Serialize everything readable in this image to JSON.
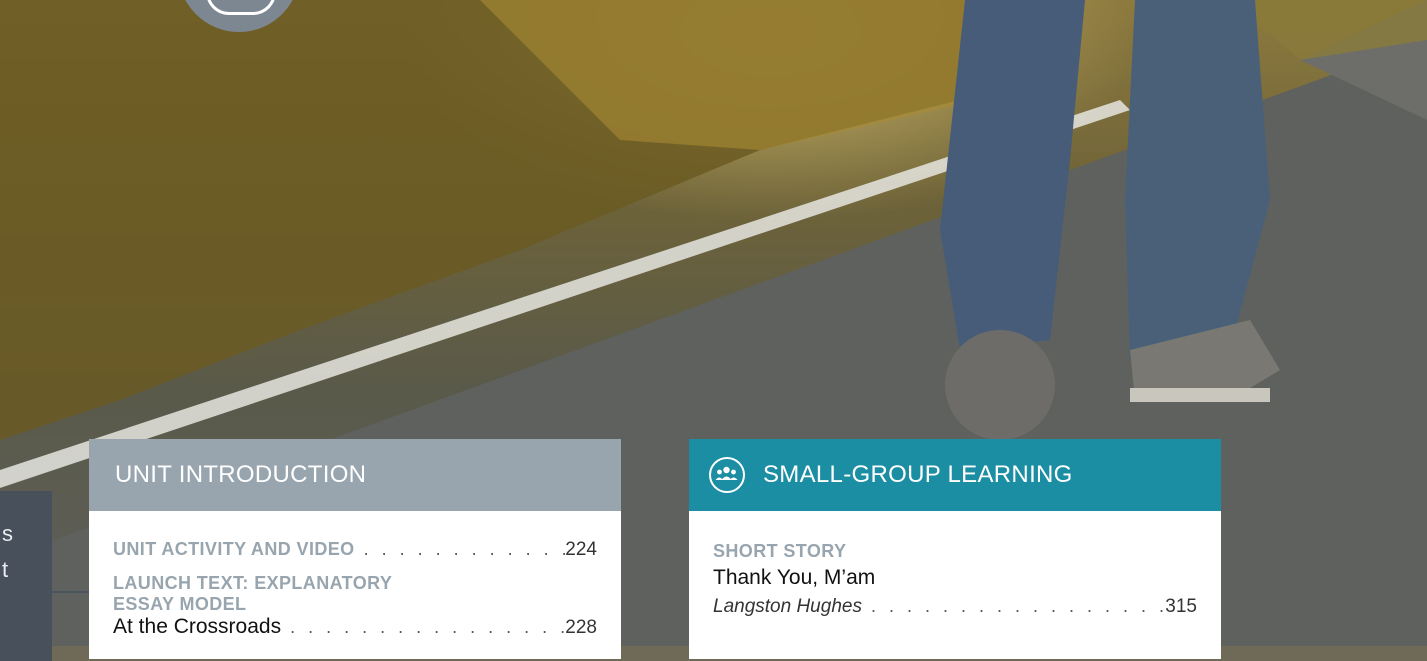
{
  "side_tab": {
    "lines": [
      "s",
      "t"
    ]
  },
  "left_card": {
    "header": "UNIT INTRODUCTION",
    "entries": [
      {
        "label": "UNIT ACTIVITY AND VIDEO",
        "page": "224"
      },
      {
        "label_line1": "LAUNCH TEXT: EXPLANATORY",
        "label_line2": "ESSAY MODEL",
        "title": "At the Crossroads",
        "page": "228"
      }
    ]
  },
  "right_card": {
    "header": "SMALL-GROUP LEARNING",
    "icon": "group-icon",
    "entries": [
      {
        "label": "SHORT STORY",
        "title": "Thank You, M’am",
        "author": "Langston Hughes",
        "page": "315"
      }
    ]
  },
  "colors": {
    "left_header": "#98a5ae",
    "right_header": "#1b8ea3",
    "side_tab": "#47505b"
  }
}
